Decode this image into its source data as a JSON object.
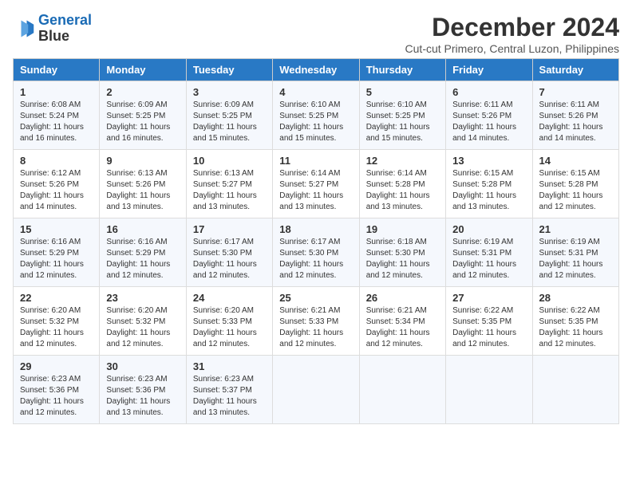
{
  "logo": {
    "line1": "General",
    "line2": "Blue"
  },
  "title": "December 2024",
  "subtitle": "Cut-cut Primero, Central Luzon, Philippines",
  "days_of_week": [
    "Sunday",
    "Monday",
    "Tuesday",
    "Wednesday",
    "Thursday",
    "Friday",
    "Saturday"
  ],
  "weeks": [
    [
      {
        "day": 1,
        "rise": "6:08 AM",
        "set": "5:24 PM",
        "daylight": "11 hours and 16 minutes."
      },
      {
        "day": 2,
        "rise": "6:09 AM",
        "set": "5:25 PM",
        "daylight": "11 hours and 16 minutes."
      },
      {
        "day": 3,
        "rise": "6:09 AM",
        "set": "5:25 PM",
        "daylight": "11 hours and 15 minutes."
      },
      {
        "day": 4,
        "rise": "6:10 AM",
        "set": "5:25 PM",
        "daylight": "11 hours and 15 minutes."
      },
      {
        "day": 5,
        "rise": "6:10 AM",
        "set": "5:25 PM",
        "daylight": "11 hours and 15 minutes."
      },
      {
        "day": 6,
        "rise": "6:11 AM",
        "set": "5:26 PM",
        "daylight": "11 hours and 14 minutes."
      },
      {
        "day": 7,
        "rise": "6:11 AM",
        "set": "5:26 PM",
        "daylight": "11 hours and 14 minutes."
      }
    ],
    [
      {
        "day": 8,
        "rise": "6:12 AM",
        "set": "5:26 PM",
        "daylight": "11 hours and 14 minutes."
      },
      {
        "day": 9,
        "rise": "6:13 AM",
        "set": "5:26 PM",
        "daylight": "11 hours and 13 minutes."
      },
      {
        "day": 10,
        "rise": "6:13 AM",
        "set": "5:27 PM",
        "daylight": "11 hours and 13 minutes."
      },
      {
        "day": 11,
        "rise": "6:14 AM",
        "set": "5:27 PM",
        "daylight": "11 hours and 13 minutes."
      },
      {
        "day": 12,
        "rise": "6:14 AM",
        "set": "5:28 PM",
        "daylight": "11 hours and 13 minutes."
      },
      {
        "day": 13,
        "rise": "6:15 AM",
        "set": "5:28 PM",
        "daylight": "11 hours and 13 minutes."
      },
      {
        "day": 14,
        "rise": "6:15 AM",
        "set": "5:28 PM",
        "daylight": "11 hours and 12 minutes."
      }
    ],
    [
      {
        "day": 15,
        "rise": "6:16 AM",
        "set": "5:29 PM",
        "daylight": "11 hours and 12 minutes."
      },
      {
        "day": 16,
        "rise": "6:16 AM",
        "set": "5:29 PM",
        "daylight": "11 hours and 12 minutes."
      },
      {
        "day": 17,
        "rise": "6:17 AM",
        "set": "5:30 PM",
        "daylight": "11 hours and 12 minutes."
      },
      {
        "day": 18,
        "rise": "6:17 AM",
        "set": "5:30 PM",
        "daylight": "11 hours and 12 minutes."
      },
      {
        "day": 19,
        "rise": "6:18 AM",
        "set": "5:30 PM",
        "daylight": "11 hours and 12 minutes."
      },
      {
        "day": 20,
        "rise": "6:19 AM",
        "set": "5:31 PM",
        "daylight": "11 hours and 12 minutes."
      },
      {
        "day": 21,
        "rise": "6:19 AM",
        "set": "5:31 PM",
        "daylight": "11 hours and 12 minutes."
      }
    ],
    [
      {
        "day": 22,
        "rise": "6:20 AM",
        "set": "5:32 PM",
        "daylight": "11 hours and 12 minutes."
      },
      {
        "day": 23,
        "rise": "6:20 AM",
        "set": "5:32 PM",
        "daylight": "11 hours and 12 minutes."
      },
      {
        "day": 24,
        "rise": "6:20 AM",
        "set": "5:33 PM",
        "daylight": "11 hours and 12 minutes."
      },
      {
        "day": 25,
        "rise": "6:21 AM",
        "set": "5:33 PM",
        "daylight": "11 hours and 12 minutes."
      },
      {
        "day": 26,
        "rise": "6:21 AM",
        "set": "5:34 PM",
        "daylight": "11 hours and 12 minutes."
      },
      {
        "day": 27,
        "rise": "6:22 AM",
        "set": "5:35 PM",
        "daylight": "11 hours and 12 minutes."
      },
      {
        "day": 28,
        "rise": "6:22 AM",
        "set": "5:35 PM",
        "daylight": "11 hours and 12 minutes."
      }
    ],
    [
      {
        "day": 29,
        "rise": "6:23 AM",
        "set": "5:36 PM",
        "daylight": "11 hours and 12 minutes."
      },
      {
        "day": 30,
        "rise": "6:23 AM",
        "set": "5:36 PM",
        "daylight": "11 hours and 13 minutes."
      },
      {
        "day": 31,
        "rise": "6:23 AM",
        "set": "5:37 PM",
        "daylight": "11 hours and 13 minutes."
      },
      null,
      null,
      null,
      null
    ]
  ]
}
